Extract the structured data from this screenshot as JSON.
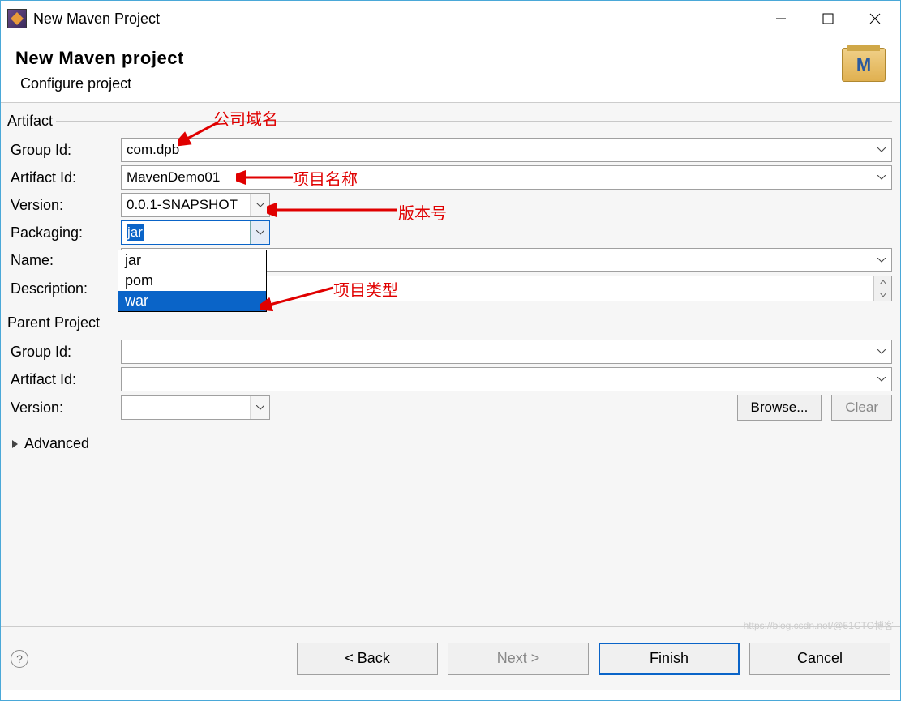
{
  "window": {
    "title": "New Maven Project"
  },
  "banner": {
    "title": "New Maven project",
    "subtitle": "Configure project",
    "icon_letter": "M"
  },
  "artifact": {
    "legend": "Artifact",
    "group_id_label": "Group Id:",
    "group_id_value": "com.dpb",
    "artifact_id_label": "Artifact Id:",
    "artifact_id_value": "MavenDemo01",
    "version_label": "Version:",
    "version_value": "0.0.1-SNAPSHOT",
    "packaging_label": "Packaging:",
    "packaging_value": "jar",
    "packaging_options": [
      "jar",
      "pom",
      "war"
    ],
    "packaging_selected_index": 2,
    "name_label": "Name:",
    "name_value": "",
    "description_label": "Description:",
    "description_value": ""
  },
  "parent": {
    "legend": "Parent Project",
    "group_id_label": "Group Id:",
    "group_id_value": "",
    "artifact_id_label": "Artifact Id:",
    "artifact_id_value": "",
    "version_label": "Version:",
    "version_value": "",
    "browse_label": "Browse...",
    "clear_label": "Clear"
  },
  "advanced_label": "Advanced",
  "annotations": {
    "company_domain": "公司域名",
    "project_name": "项目名称",
    "version_no": "版本号",
    "project_type": "项目类型"
  },
  "buttons": {
    "back": "< Back",
    "next": "Next >",
    "finish": "Finish",
    "cancel": "Cancel"
  },
  "watermark": "https://blog.csdn.net/@51CTO博客"
}
